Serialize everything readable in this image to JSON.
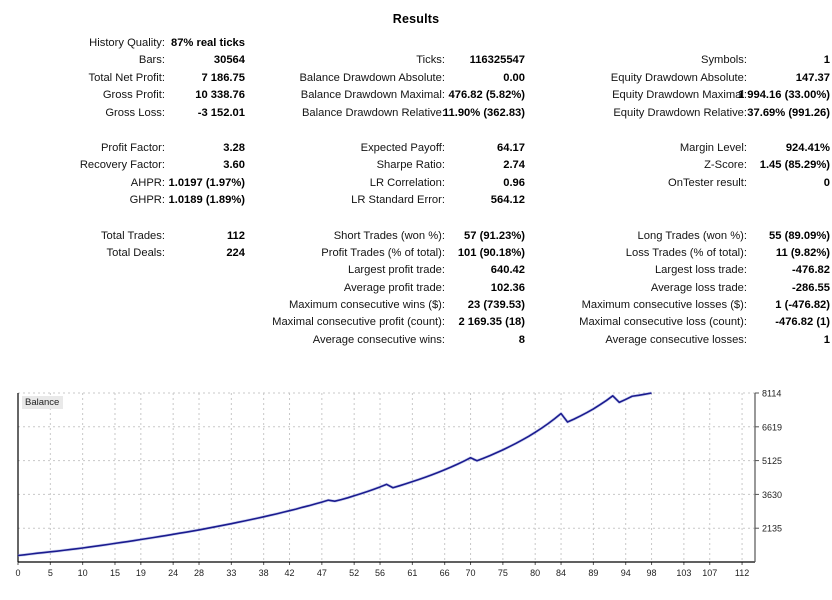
{
  "title": "Results",
  "stats": {
    "blocks": [
      {
        "rows": [
          {
            "c1": {
              "label": "History Quality:",
              "value": "87% real ticks"
            },
            "c2": {
              "label": "",
              "value": ""
            },
            "c3": {
              "label": "",
              "value": ""
            }
          },
          {
            "c1": {
              "label": "Bars:",
              "value": "30564"
            },
            "c2": {
              "label": "Ticks:",
              "value": "116325547"
            },
            "c3": {
              "label": "Symbols:",
              "value": "1"
            }
          },
          {
            "c1": {
              "label": "Total Net Profit:",
              "value": "7 186.75"
            },
            "c2": {
              "label": "Balance Drawdown Absolute:",
              "value": "0.00"
            },
            "c3": {
              "label": "Equity Drawdown Absolute:",
              "value": "147.37"
            }
          },
          {
            "c1": {
              "label": "Gross Profit:",
              "value": "10 338.76"
            },
            "c2": {
              "label": "Balance Drawdown Maximal:",
              "value": "476.82 (5.82%)"
            },
            "c3": {
              "label": "Equity Drawdown Maximal:",
              "value": "1 994.16 (33.00%)"
            }
          },
          {
            "c1": {
              "label": "Gross Loss:",
              "value": "-3 152.01"
            },
            "c2": {
              "label": "Balance Drawdown Relative:",
              "value": "11.90% (362.83)"
            },
            "c3": {
              "label": "Equity Drawdown Relative:",
              "value": "37.69% (991.26)"
            }
          }
        ]
      },
      {
        "rows": [
          {
            "c1": {
              "label": "Profit Factor:",
              "value": "3.28"
            },
            "c2": {
              "label": "Expected Payoff:",
              "value": "64.17"
            },
            "c3": {
              "label": "Margin Level:",
              "value": "924.41%"
            }
          },
          {
            "c1": {
              "label": "Recovery Factor:",
              "value": "3.60"
            },
            "c2": {
              "label": "Sharpe Ratio:",
              "value": "2.74"
            },
            "c3": {
              "label": "Z-Score:",
              "value": "1.45 (85.29%)"
            }
          },
          {
            "c1": {
              "label": "AHPR:",
              "value": "1.0197 (1.97%)"
            },
            "c2": {
              "label": "LR Correlation:",
              "value": "0.96"
            },
            "c3": {
              "label": "OnTester result:",
              "value": "0"
            }
          },
          {
            "c1": {
              "label": "GHPR:",
              "value": "1.0189 (1.89%)"
            },
            "c2": {
              "label": "LR Standard Error:",
              "value": "564.12"
            },
            "c3": {
              "label": "",
              "value": ""
            }
          }
        ]
      },
      {
        "rows": [
          {
            "c1": {
              "label": "Total Trades:",
              "value": "112"
            },
            "c2": {
              "label": "Short Trades (won %):",
              "value": "57 (91.23%)"
            },
            "c3": {
              "label": "Long Trades (won %):",
              "value": "55 (89.09%)"
            }
          },
          {
            "c1": {
              "label": "Total Deals:",
              "value": "224"
            },
            "c2": {
              "label": "Profit Trades (% of total):",
              "value": "101 (90.18%)"
            },
            "c3": {
              "label": "Loss Trades (% of total):",
              "value": "11 (9.82%)"
            }
          },
          {
            "c1": {
              "label": "",
              "value": ""
            },
            "c2": {
              "label": "Largest profit trade:",
              "value": "640.42"
            },
            "c3": {
              "label": "Largest loss trade:",
              "value": "-476.82"
            }
          },
          {
            "c1": {
              "label": "",
              "value": ""
            },
            "c2": {
              "label": "Average profit trade:",
              "value": "102.36"
            },
            "c3": {
              "label": "Average loss trade:",
              "value": "-286.55"
            }
          },
          {
            "c1": {
              "label": "",
              "value": ""
            },
            "c2": {
              "label": "Maximum consecutive wins ($):",
              "value": "23 (739.53)"
            },
            "c3": {
              "label": "Maximum consecutive losses ($):",
              "value": "1 (-476.82)"
            }
          },
          {
            "c1": {
              "label": "",
              "value": ""
            },
            "c2": {
              "label": "Maximal consecutive profit (count):",
              "value": "2 169.35 (18)"
            },
            "c3": {
              "label": "Maximal consecutive loss (count):",
              "value": "-476.82 (1)"
            }
          },
          {
            "c1": {
              "label": "",
              "value": ""
            },
            "c2": {
              "label": "Average consecutive wins:",
              "value": "8"
            },
            "c3": {
              "label": "Average consecutive losses:",
              "value": "1"
            }
          }
        ]
      }
    ]
  },
  "chart_data": {
    "type": "line",
    "title": "",
    "legend": "Balance",
    "legend_position": "top-left",
    "line_color": "#1b1b8f",
    "grid": true,
    "xlabel": "",
    "ylabel": "",
    "xlim": [
      0,
      114
    ],
    "ylim": [
      641,
      8114
    ],
    "x_ticks": [
      0,
      5,
      10,
      15,
      19,
      24,
      28,
      33,
      38,
      42,
      47,
      52,
      56,
      61,
      66,
      70,
      75,
      80,
      84,
      89,
      94,
      98,
      103,
      107,
      112
    ],
    "y_ticks": [
      641,
      2135,
      3630,
      5125,
      6619,
      8114
    ],
    "series": [
      {
        "name": "Balance",
        "x": [
          0,
          1,
          2,
          3,
          4,
          5,
          6,
          7,
          8,
          9,
          10,
          11,
          12,
          13,
          14,
          15,
          16,
          17,
          18,
          19,
          20,
          21,
          22,
          23,
          24,
          25,
          26,
          27,
          28,
          29,
          30,
          31,
          32,
          33,
          34,
          35,
          36,
          37,
          38,
          39,
          40,
          41,
          42,
          43,
          44,
          45,
          46,
          47,
          48,
          49,
          50,
          51,
          52,
          53,
          54,
          55,
          56,
          57,
          58,
          59,
          60,
          61,
          62,
          63,
          64,
          65,
          66,
          67,
          68,
          69,
          70,
          71,
          72,
          73,
          74,
          75,
          76,
          77,
          78,
          79,
          80,
          81,
          82,
          83,
          84,
          85,
          86,
          87,
          88,
          89,
          90,
          91,
          92,
          93,
          94,
          95,
          96,
          97,
          98,
          99,
          100,
          101,
          102,
          103,
          104,
          105,
          106,
          107,
          108,
          109,
          110,
          111,
          112
        ],
        "y": [
          928,
          960,
          995,
          1030,
          1060,
          1090,
          1120,
          1155,
          1190,
          1225,
          1260,
          1300,
          1340,
          1380,
          1420,
          1465,
          1505,
          1545,
          1590,
          1635,
          1680,
          1725,
          1770,
          1815,
          1865,
          1915,
          1960,
          2010,
          2060,
          2115,
          2170,
          2225,
          2280,
          2335,
          2395,
          2455,
          2515,
          2575,
          2640,
          2705,
          2770,
          2840,
          2910,
          2980,
          3060,
          3130,
          3210,
          3290,
          3375,
          3330,
          3400,
          3480,
          3570,
          3660,
          3755,
          3855,
          3960,
          4075,
          3925,
          4010,
          4100,
          4195,
          4290,
          4390,
          4495,
          4605,
          4720,
          4840,
          4970,
          5105,
          5250,
          5120,
          5230,
          5345,
          5470,
          5600,
          5740,
          5885,
          6040,
          6200,
          6375,
          6560,
          6760,
          6975,
          7205,
          6830,
          6960,
          7100,
          7250,
          7410,
          7590,
          7780,
          7990,
          7700,
          7830,
          7970,
          8010,
          8060,
          8114
        ]
      }
    ]
  }
}
